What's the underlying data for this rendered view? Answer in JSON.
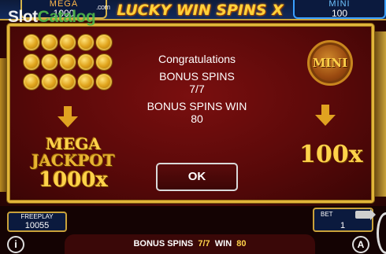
{
  "watermark": {
    "slot": "Slot",
    "catalog": "Catalog",
    "com": ".com"
  },
  "header": {
    "mega_label": "MEGA",
    "mega_value": "1000",
    "title": "LUCKY WIN SPINS X",
    "mini_label": "MINI",
    "mini_value": "100"
  },
  "popup": {
    "congrats": "Congratulations",
    "bonus_spins_label": "BONUS SPINS",
    "bonus_spins_value": "7/7",
    "bonus_win_label": "BONUS SPINS WIN",
    "bonus_win_value": "80",
    "ok_label": "OK",
    "mega_jackpot": {
      "line1": "MEGA",
      "line2": "JACKPOT",
      "line3": "1000x"
    },
    "mini_coin_label": "MINI",
    "mini_multiplier": "100x"
  },
  "bottom": {
    "freeplay_label": "FREEPLAY",
    "freeplay_value": "10055",
    "bet_label": "BET",
    "bet_value": "1",
    "status_spins_label": "BONUS SPINS",
    "status_spins_value": "7/7",
    "status_win_label": "WIN",
    "status_win_value": "80",
    "info_icon": "i",
    "auto_icon": "A"
  },
  "colors": {
    "gold": "#ffd24a",
    "popup_border": "#e2b53a",
    "popup_bg": "#5a0909"
  }
}
